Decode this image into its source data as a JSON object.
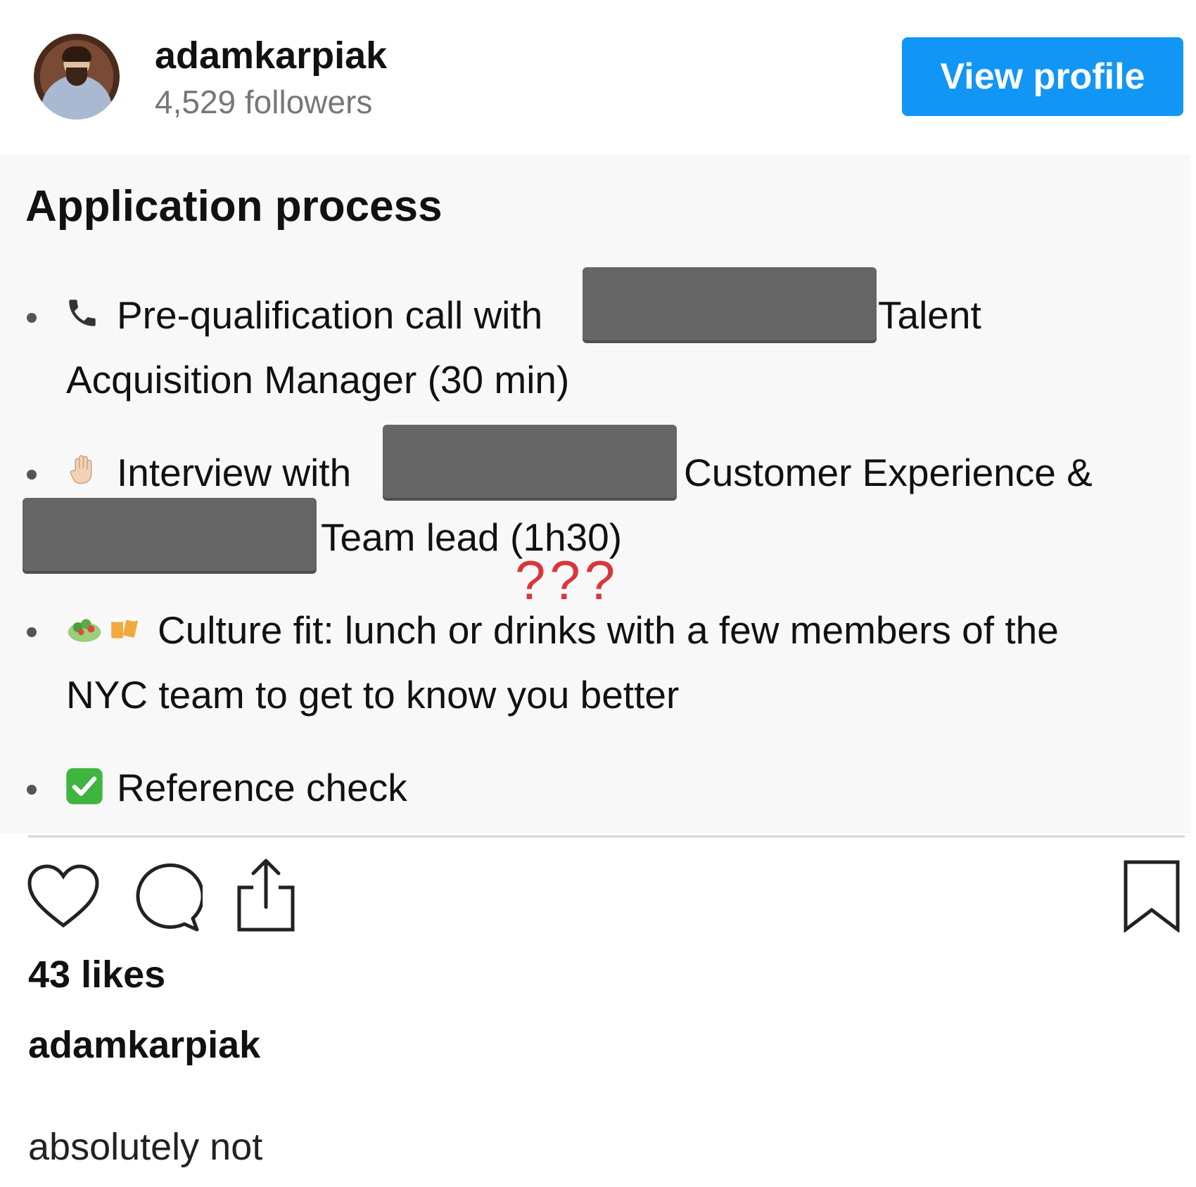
{
  "header": {
    "username": "adamkarpiak",
    "followers": "4,529 followers",
    "view_profile_label": "View profile"
  },
  "post": {
    "title": "Application process",
    "items": [
      {
        "line1": "Pre-qualification call with",
        "line1b": "Talent",
        "line2": "Acquisition Manager (30 min)"
      },
      {
        "line1": "Interview with",
        "line1b": "Customer Experience &",
        "line2": "Team lead (1h30)"
      },
      {
        "line1": "Culture fit: lunch or drinks with a few members of the",
        "line2": "NYC team to get to know you better"
      },
      {
        "line1": "Reference check"
      }
    ],
    "annotation": "???"
  },
  "actions": {
    "like_icon": "heart-icon",
    "comment_icon": "comment-icon",
    "share_icon": "share-icon",
    "save_icon": "bookmark-icon"
  },
  "likes": "43 likes",
  "caption": {
    "username": "adamkarpiak",
    "text": "absolutely not"
  }
}
